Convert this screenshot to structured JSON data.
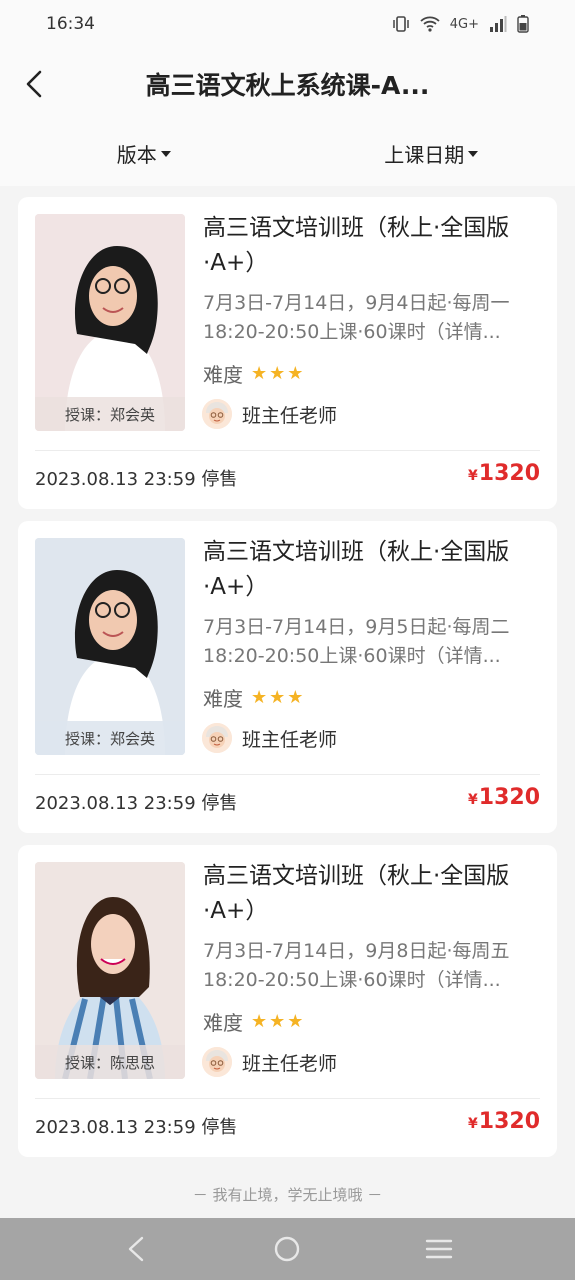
{
  "status_bar": {
    "time": "16:34",
    "network": "4G+"
  },
  "nav": {
    "title": "高三语文秋上系统课-A..."
  },
  "filters": [
    {
      "label": "版本"
    },
    {
      "label": "上课日期"
    }
  ],
  "courses": [
    {
      "title": "高三语文培训班（秋上·全国版·A+）",
      "schedule": "7月3日-7月14日，9月4日起·每周一18:20-20:50上课·60课时（详情...",
      "difficulty_label": "难度",
      "difficulty_stars": 3,
      "teacher_label": "授课：郑会英",
      "head_teacher": "班主任老师",
      "stop_time": "2023.08.13 23:59 停售",
      "price_symbol": "¥",
      "price": "1320",
      "photo_bg": "#f1e4e4"
    },
    {
      "title": "高三语文培训班（秋上·全国版·A+）",
      "schedule": "7月3日-7月14日，9月5日起·每周二18:20-20:50上课·60课时（详情...",
      "difficulty_label": "难度",
      "difficulty_stars": 3,
      "teacher_label": "授课：郑会英",
      "head_teacher": "班主任老师",
      "stop_time": "2023.08.13 23:59 停售",
      "price_symbol": "¥",
      "price": "1320",
      "photo_bg": "#dfe6ee"
    },
    {
      "title": "高三语文培训班（秋上·全国版·A+）",
      "schedule": "7月3日-7月14日，9月8日起·每周五18:20-20:50上课·60课时（详情...",
      "difficulty_label": "难度",
      "difficulty_stars": 3,
      "teacher_label": "授课：陈思思",
      "head_teacher": "班主任老师",
      "stop_time": "2023.08.13 23:59 停售",
      "price_symbol": "¥",
      "price": "1320",
      "photo_bg": "#efe5e2"
    }
  ],
  "footer": {
    "slogan": "－ 我有止境，学无止境哦 －"
  },
  "colors": {
    "price": "#e02b2b",
    "star": "#f5b324",
    "background": "#f4f4f4"
  }
}
